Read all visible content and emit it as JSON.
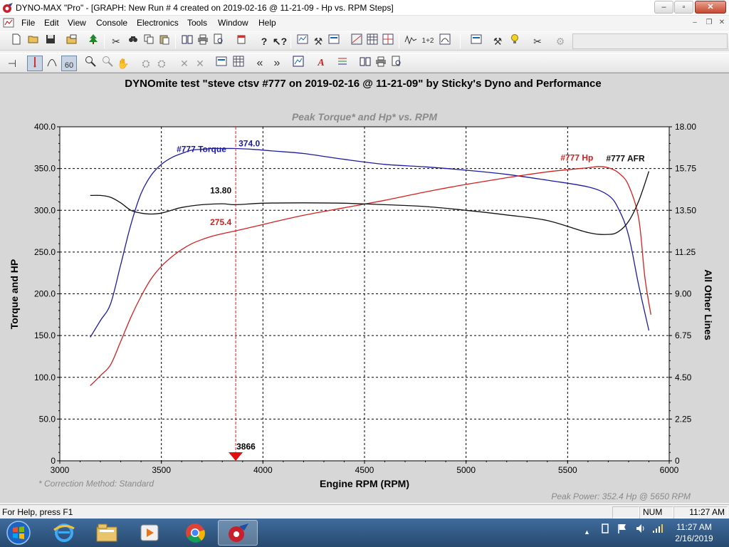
{
  "window": {
    "title": "DYNO-MAX \"Pro\" - [GRAPH: New Run # 4 created on 2019-02-16 @ 11-21-09 - Hp vs. RPM Steps]",
    "minimize": "–",
    "maximize": "▫",
    "close": "✕"
  },
  "menu": {
    "items": [
      "File",
      "Edit",
      "View",
      "Console",
      "Electronics",
      "Tools",
      "Window",
      "Help"
    ],
    "mdi_minimize": "–",
    "mdi_restore": "❐",
    "mdi_close": "✕"
  },
  "toolbar1": {
    "icons": [
      "new-file-icon",
      "open-folder-icon",
      "save-icon",
      "open-run-icon",
      "tree-icon",
      "cut-icon",
      "find-icon",
      "copy-icon",
      "paste-icon",
      "book-icon",
      "print-icon",
      "print-preview-icon",
      "export-icon",
      "help-icon",
      "context-help-icon",
      "graph-settings-icon",
      "tools-icon",
      "gauge-icon",
      "spreadsheet-icon",
      "table-icon",
      "run-compare-icon",
      "wave-icon",
      "step-counter-icon",
      "meter-icon",
      "graph-config-icon",
      "wrench-icon",
      "bulb-icon",
      "calibrate-icon",
      "disabled-tool-icon"
    ],
    "step_label": "1+2"
  },
  "toolbar2": {
    "icons": [
      "pin-icon",
      "cursor-marker-icon",
      "curve-icon",
      "smooth-icon",
      "zoom-in-icon",
      "zoom-out-icon",
      "pan-hand-icon",
      "dyno-a-icon",
      "dyno-b-icon",
      "trace-icon",
      "trace-off-icon",
      "graph-options-icon",
      "grid-icon",
      "step-back-icon",
      "step-forward-icon",
      "chart-icon",
      "font-icon",
      "legend-icon",
      "book2-icon",
      "print2-icon",
      "preview2-icon"
    ]
  },
  "graph": {
    "heading": "DYNOmite test \"steve ctsv #777 on 2019-02-16 @ 11-21-09\" by Sticky's Dyno and Performance",
    "footnote": "* Correction Method: Standard",
    "peak_power": "Peak Power: 352.4 Hp @ 5650 RPM"
  },
  "chart_data": {
    "type": "line",
    "title": "Peak Torque* and Hp* vs. RPM",
    "xlabel": "Engine RPM (RPM)",
    "ylabel": "Torque and HP",
    "y2label": "All Other Lines",
    "xlim": [
      3000,
      6000
    ],
    "ylim": [
      0,
      400
    ],
    "y2lim": [
      0,
      18
    ],
    "x_ticks": [
      "3000",
      "3500",
      "4000",
      "4500",
      "5000",
      "5500",
      "6000"
    ],
    "y_ticks": [
      "0",
      "50.0",
      "100.0",
      "150.0",
      "200.0",
      "250.0",
      "300.0",
      "350.0",
      "400.0"
    ],
    "y2_ticks": [
      "0",
      "2.25",
      "4.50",
      "6.75",
      "9.00",
      "11.25",
      "13.50",
      "15.75",
      "18.00"
    ],
    "grid": true,
    "cursor": {
      "rpm": 3866,
      "label": "3866"
    },
    "series": [
      {
        "name": "#777 Torque",
        "axis": "left",
        "color": "#1c1ca0",
        "x": [
          3150,
          3200,
          3250,
          3300,
          3350,
          3400,
          3450,
          3500,
          3550,
          3600,
          3650,
          3700,
          3750,
          3800,
          3866,
          3950,
          4050,
          4200,
          4400,
          4600,
          4800,
          5000,
          5200,
          5400,
          5600,
          5700,
          5750,
          5800,
          5850,
          5900
        ],
        "values": [
          148,
          168,
          188,
          235,
          283,
          320,
          342,
          355,
          363,
          368,
          372,
          373,
          374,
          374,
          374,
          373,
          371,
          368,
          361,
          355,
          352,
          348,
          343,
          336,
          328,
          318,
          302,
          270,
          210,
          156
        ]
      },
      {
        "name": "#777 Hp",
        "axis": "left",
        "color": "#d42020",
        "x": [
          3150,
          3200,
          3250,
          3300,
          3350,
          3400,
          3450,
          3500,
          3550,
          3600,
          3650,
          3700,
          3750,
          3800,
          3866,
          4000,
          4200,
          4400,
          4600,
          4800,
          5000,
          5200,
          5400,
          5600,
          5650,
          5700,
          5750,
          5800,
          5850,
          5880,
          5910
        ],
        "values": [
          90,
          102,
          115,
          143,
          172,
          197,
          218,
          233,
          244,
          253,
          260,
          265,
          269,
          272,
          275.4,
          283,
          294,
          303,
          312,
          322,
          331,
          339,
          346,
          351,
          352.4,
          351,
          345,
          330,
          290,
          220,
          175
        ]
      },
      {
        "name": "#777 AFR",
        "axis": "right",
        "color": "#111111",
        "x": [
          3150,
          3200,
          3250,
          3300,
          3350,
          3400,
          3450,
          3500,
          3550,
          3600,
          3700,
          3800,
          3866,
          4000,
          4200,
          4400,
          4600,
          4800,
          5000,
          5200,
          5400,
          5600,
          5700,
          5750,
          5800,
          5850,
          5900
        ],
        "values": [
          14.3,
          14.3,
          14.2,
          13.9,
          13.5,
          13.35,
          13.3,
          13.35,
          13.5,
          13.65,
          13.8,
          13.85,
          13.8,
          13.88,
          13.9,
          13.88,
          13.8,
          13.7,
          13.5,
          13.25,
          12.95,
          12.3,
          12.2,
          12.35,
          12.9,
          14.0,
          15.6
        ]
      }
    ],
    "labels": {
      "torque_value": "374.0",
      "hp_value": "275.4",
      "afr_value": "13.80"
    }
  },
  "statusbar": {
    "help_text": "For Help, press F1",
    "num": "NUM",
    "time": "11:27 AM"
  },
  "taskbar": {
    "clock_time": "11:27 AM",
    "clock_date": "2/16/2019",
    "tray_arrow": "▲"
  }
}
